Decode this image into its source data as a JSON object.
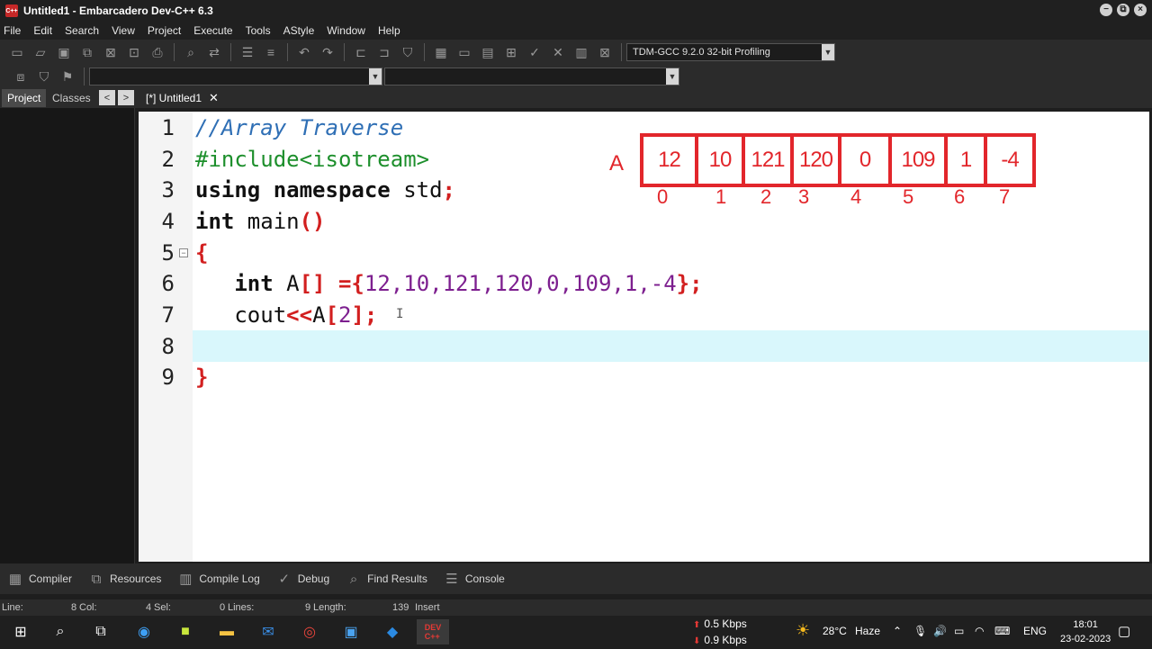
{
  "window": {
    "title": "Untitled1 - Embarcadero Dev-C++ 6.3",
    "controls": [
      "−",
      "⧉",
      "×"
    ]
  },
  "menu": [
    "File",
    "Edit",
    "Search",
    "View",
    "Project",
    "Execute",
    "Tools",
    "AStyle",
    "Window",
    "Help"
  ],
  "toolbar": {
    "compiler_profile": "TDM-GCC 9.2.0 32-bit Profiling"
  },
  "panel_tabs": {
    "project": "Project",
    "classes": "Classes",
    "prev": "<",
    "next": ">"
  },
  "file_tab": {
    "label": "[*] Untitled1",
    "close": "✕"
  },
  "editor": {
    "line_numbers": [
      "1",
      "2",
      "3",
      "4",
      "5",
      "6",
      "7",
      "8",
      "9"
    ],
    "lines": {
      "l1": "//Array Traverse",
      "l2": "#include<isotream>",
      "l3_kw1": "using",
      "l3_kw2": "namespace",
      "l3_name": " std",
      "l3_semi": ";",
      "l4_kw": "int",
      "l4_name": " main",
      "l4_paren": "()",
      "l5": "{",
      "l6_kw": "int",
      "l6_name": " A",
      "l6_br": "[]",
      "l6_eq": " ={",
      "l6_vals": "12,10,121,120,0,109,1,-4",
      "l6_end": "};",
      "l7_name": "cout",
      "l7_op": "<<",
      "l7_arr": "A",
      "l7_b1": "[",
      "l7_idx": "2",
      "l7_b2": "];",
      "l9": "}"
    }
  },
  "annotation": {
    "label": "A",
    "values": [
      "12",
      "10",
      "121",
      "120",
      "0",
      "109",
      "1",
      "-4"
    ],
    "indices": [
      "0",
      "1",
      "2",
      "3",
      "4",
      "5",
      "6",
      "7"
    ]
  },
  "bottom_tabs": [
    "Compiler",
    "Resources",
    "Compile Log",
    "Debug",
    "Find Results",
    "Console"
  ],
  "status": {
    "line_label": "Line:",
    "line_value": "8",
    "col_label": "Col:",
    "col_value": "4",
    "sel_label": "Sel:",
    "sel_value": "0",
    "lines_label": "Lines:",
    "lines_value": "9",
    "length_label": "Length:",
    "length_value": "139",
    "mode": "Insert"
  },
  "taskbar": {
    "net_up": "0.5 Kbps",
    "net_down": "0.9 Kbps",
    "weather": "28°C",
    "weather_desc": "Haze",
    "lang": "ENG",
    "time": "18:01",
    "date": "23-02-2023"
  },
  "colors": {
    "annotation_red": "#e2262b",
    "current_line": "#d9f7fc",
    "comment_blue": "#2f6fb5",
    "preprocessor_green": "#1d8f2c",
    "number_purple": "#7d1f8f",
    "symbol_red": "#d21f1f"
  }
}
